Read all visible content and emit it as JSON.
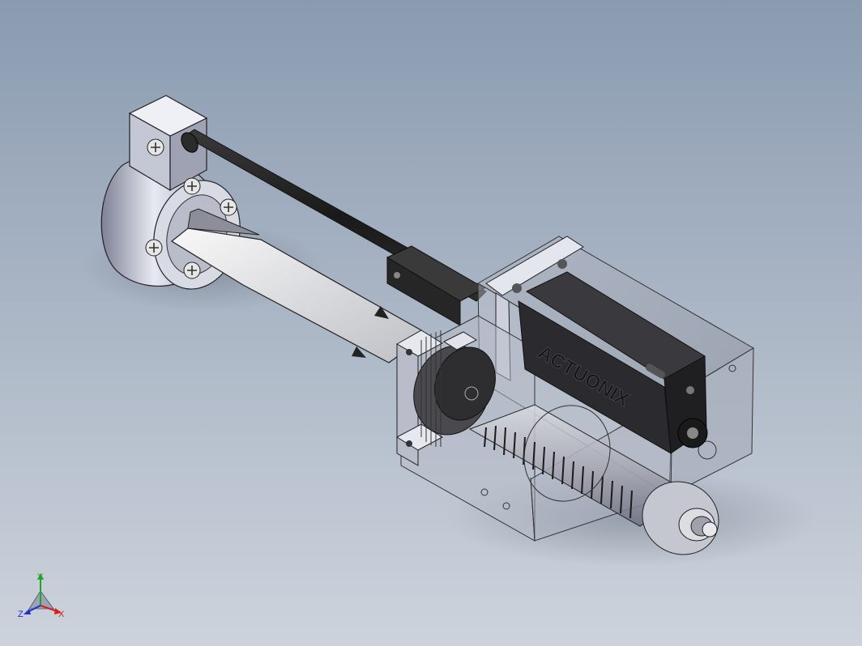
{
  "viewport": {
    "background_top": "#8a9bb0",
    "background_bottom": "#c9d0da"
  },
  "model": {
    "brand_text": "ACTUONIX"
  },
  "triad": {
    "x_label": "X",
    "y_label": "Y",
    "z_label": "Z",
    "x_color": "#d42020",
    "y_color": "#1fa52a",
    "z_color": "#2030c8"
  }
}
